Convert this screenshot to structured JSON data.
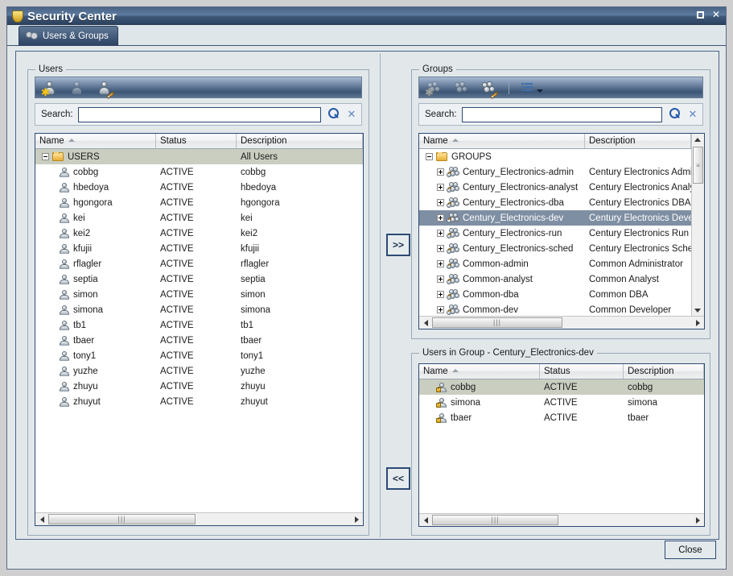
{
  "window": {
    "title": "Security Center",
    "icon": "shield-icon",
    "controls": {
      "maximize": "□",
      "close": "✕"
    }
  },
  "tabs": [
    {
      "label": "Users & Groups",
      "icon": "users-group-icon",
      "active": true
    }
  ],
  "users_panel": {
    "title": "Users",
    "toolbar": [
      {
        "name": "add-user",
        "icon": "add-user-icon",
        "enabled": true
      },
      {
        "name": "delete-user",
        "icon": "delete-user-icon",
        "enabled": false
      },
      {
        "name": "edit-user",
        "icon": "edit-user-icon",
        "enabled": true
      }
    ],
    "search": {
      "label": "Search:",
      "value": "",
      "placeholder": "",
      "search_icon": "magnifier-icon",
      "clear_icon": "clear-x-icon"
    },
    "columns": [
      "Name",
      "Status",
      "Description"
    ],
    "sorted_column": "Name",
    "root": {
      "name": "USERS",
      "status": "",
      "description": "All Users",
      "expanded": true,
      "selected": true
    },
    "rows": [
      {
        "name": "cobbg",
        "status": "ACTIVE",
        "description": "cobbg"
      },
      {
        "name": "hbedoya",
        "status": "ACTIVE",
        "description": "hbedoya"
      },
      {
        "name": "hgongora",
        "status": "ACTIVE",
        "description": "hgongora"
      },
      {
        "name": "kei",
        "status": "ACTIVE",
        "description": "kei"
      },
      {
        "name": "kei2",
        "status": "ACTIVE",
        "description": "kei2"
      },
      {
        "name": "kfujii",
        "status": "ACTIVE",
        "description": "kfujii"
      },
      {
        "name": "rflagler",
        "status": "ACTIVE",
        "description": "rflagler"
      },
      {
        "name": "septia",
        "status": "ACTIVE",
        "description": "septia"
      },
      {
        "name": "simon",
        "status": "ACTIVE",
        "description": "simon"
      },
      {
        "name": "simona",
        "status": "ACTIVE",
        "description": "simona"
      },
      {
        "name": "tb1",
        "status": "ACTIVE",
        "description": "tb1"
      },
      {
        "name": "tbaer",
        "status": "ACTIVE",
        "description": "tbaer"
      },
      {
        "name": "tony1",
        "status": "ACTIVE",
        "description": "tony1"
      },
      {
        "name": "yuzhe",
        "status": "ACTIVE",
        "description": "yuzhe"
      },
      {
        "name": "zhuyu",
        "status": "ACTIVE",
        "description": "zhuyu"
      },
      {
        "name": "zhuyut",
        "status": "ACTIVE",
        "description": "zhuyut"
      }
    ]
  },
  "groups_panel": {
    "title": "Groups",
    "toolbar": [
      {
        "name": "add-group",
        "icon": "add-group-icon",
        "enabled": false
      },
      {
        "name": "delete-group",
        "icon": "delete-group-icon",
        "enabled": false
      },
      {
        "name": "edit-group",
        "icon": "edit-group-icon",
        "enabled": true
      },
      {
        "name": "view-options",
        "icon": "list-view-icon",
        "enabled": true
      }
    ],
    "search": {
      "label": "Search:",
      "value": "",
      "placeholder": "",
      "search_icon": "magnifier-icon",
      "clear_icon": "clear-x-icon"
    },
    "columns": [
      "Name",
      "Description"
    ],
    "sorted_column": "Name",
    "root": {
      "name": "GROUPS",
      "description": "",
      "expanded": true
    },
    "rows": [
      {
        "name": "Century_Electronics-admin",
        "description": "Century Electronics Administrat",
        "selected": false
      },
      {
        "name": "Century_Electronics-analyst",
        "description": "Century Electronics Analyst",
        "selected": false
      },
      {
        "name": "Century_Electronics-dba",
        "description": "Century Electronics DBA",
        "selected": false
      },
      {
        "name": "Century_Electronics-dev",
        "description": "Century Electronics Develope",
        "selected": true
      },
      {
        "name": "Century_Electronics-run",
        "description": "Century Electronics Run",
        "selected": false
      },
      {
        "name": "Century_Electronics-sched",
        "description": "Century Electronics Schedule",
        "selected": false
      },
      {
        "name": "Common-admin",
        "description": "Common Administrator",
        "selected": false
      },
      {
        "name": "Common-analyst",
        "description": "Common Analyst",
        "selected": false
      },
      {
        "name": "Common-dba",
        "description": "Common DBA",
        "selected": false
      },
      {
        "name": "Common-dev",
        "description": "Common Developer",
        "selected": false
      }
    ]
  },
  "users_in_group_panel": {
    "title": "Users in Group - Century_Electronics-dev",
    "columns": [
      "Name",
      "Status",
      "Description"
    ],
    "sorted_column": "Name",
    "rows": [
      {
        "name": "cobbg",
        "status": "ACTIVE",
        "description": "cobbg",
        "selected": true
      },
      {
        "name": "simona",
        "status": "ACTIVE",
        "description": "simona",
        "selected": false
      },
      {
        "name": "tbaer",
        "status": "ACTIVE",
        "description": "tbaer",
        "selected": false
      }
    ]
  },
  "transfer": {
    "add_label": ">>",
    "remove_label": "<<"
  },
  "footer": {
    "close_label": "Close"
  },
  "colors": {
    "titlebar": "#3f5878",
    "selection_blue": "#7f8fa3",
    "selection_olive": "#c9cec0",
    "panel_bg": "#e2e8ea",
    "border": "#2c4a74"
  }
}
